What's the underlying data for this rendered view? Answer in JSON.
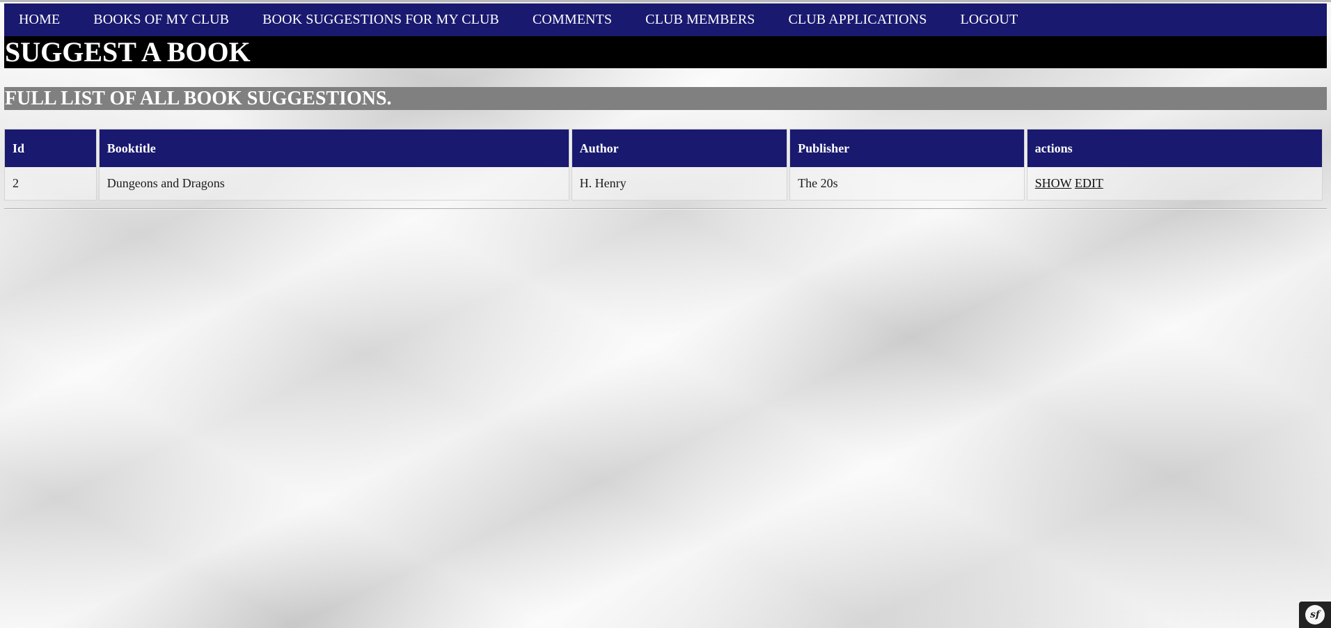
{
  "nav": {
    "items": [
      {
        "label": "HOME"
      },
      {
        "label": "BOOKS OF MY CLUB"
      },
      {
        "label": "BOOK SUGGESTIONS FOR MY CLUB"
      },
      {
        "label": "COMMENTS"
      },
      {
        "label": "CLUB MEMBERS"
      },
      {
        "label": "CLUB APPLICATIONS"
      },
      {
        "label": "LOGOUT"
      }
    ]
  },
  "page_title": "SUGGEST A BOOK",
  "section_title": "FULL LIST OF ALL BOOK SUGGESTIONS.",
  "table": {
    "headers": [
      "Id",
      "Booktitle",
      "Author",
      "Publisher",
      "actions"
    ],
    "rows": [
      {
        "id": "2",
        "booktitle": "Dungeons and Dragons",
        "author": "H. Henry",
        "publisher": "The 20s",
        "actions": {
          "show": "SHOW",
          "edit": "EDIT"
        }
      }
    ]
  },
  "toolbar": {
    "logo_text": "sf",
    "icon": "symfony-logo-icon"
  },
  "colors": {
    "nav_bg": "#191970",
    "title_bg": "#000000",
    "subtitle_bg": "#808080",
    "header_bg": "#191970"
  }
}
